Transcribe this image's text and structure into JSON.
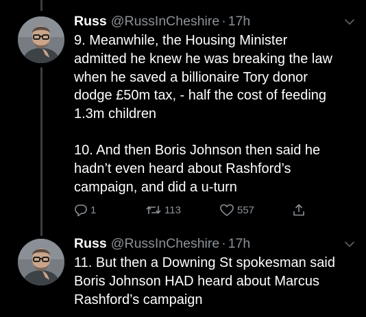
{
  "tweets": [
    {
      "name": "Russ",
      "handle": "@RussInCheshire",
      "separator": "·",
      "time": "17h",
      "paragraphs": [
        {
          "lines": [
            "9. Meanwhile, the Housing Minister",
            "admitted he knew he was breaking the law",
            "when he saved a billionaire Tory donor",
            "dodge £50m tax, - half the cost of feeding",
            "1.3m children"
          ]
        },
        {
          "lines": [
            "10. And then Boris Johnson then said he",
            "hadn’t even heard about Rashford’s",
            "campaign, and did a u-turn"
          ]
        }
      ],
      "actions": {
        "replies": "1",
        "retweets": "113",
        "likes": "557"
      }
    },
    {
      "name": "Russ",
      "handle": "@RussInCheshire",
      "separator": "·",
      "time": "17h",
      "paragraphs": [
        {
          "lines": [
            "11. But then a Downing St spokesman said",
            "Boris Johnson HAD heard about Marcus",
            "Rashford’s campaign"
          ]
        }
      ]
    }
  ],
  "icons": {
    "reply": "reply-icon",
    "retweet": "retweet-icon",
    "like": "heart-icon",
    "share": "share-icon",
    "menu": "chevron-down-icon"
  },
  "colors": {
    "background": "#000000",
    "text": "#ffffff",
    "muted": "#8b9298",
    "thread_line": "#3a3d41"
  }
}
